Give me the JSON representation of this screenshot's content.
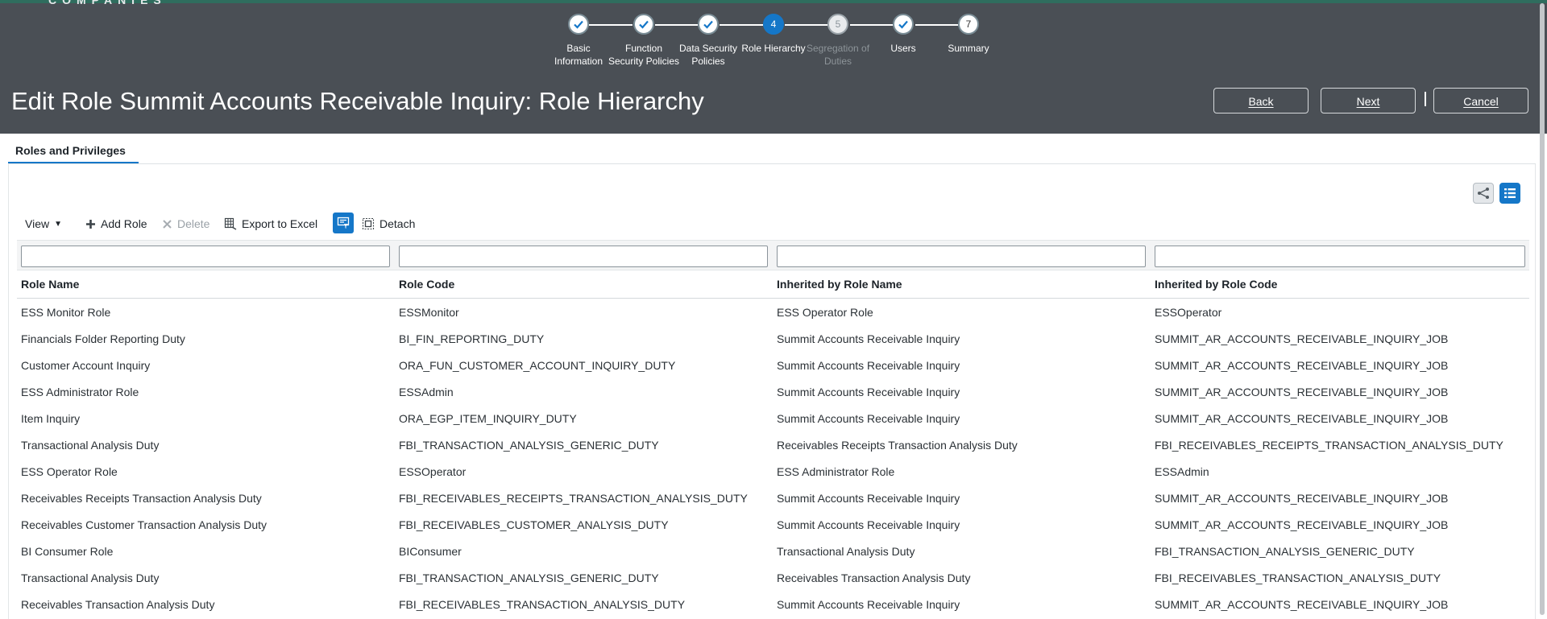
{
  "header": {
    "logo_fragment": "COMPANIES",
    "title": "Edit Role Summit Accounts Receivable Inquiry: Role Hierarchy",
    "buttons": {
      "back": "Back",
      "next": "Next",
      "cancel": "Cancel"
    }
  },
  "train": {
    "steps": [
      {
        "number": "1",
        "label_line1": "Basic",
        "label_line2": "Information",
        "state": "done"
      },
      {
        "number": "2",
        "label_line1": "Function",
        "label_line2": "Security Policies",
        "state": "done"
      },
      {
        "number": "3",
        "label_line1": "Data Security",
        "label_line2": "Policies",
        "state": "done"
      },
      {
        "number": "4",
        "label_line1": "Role Hierarchy",
        "label_line2": "",
        "state": "current"
      },
      {
        "number": "5",
        "label_line1": "Segregation of",
        "label_line2": "Duties",
        "state": "disabled"
      },
      {
        "number": "6",
        "label_line1": "Users",
        "label_line2": "",
        "state": "done"
      },
      {
        "number": "7",
        "label_line1": "Summary",
        "label_line2": "",
        "state": "todo"
      }
    ]
  },
  "tabs": {
    "roles_privileges": "Roles and Privileges"
  },
  "view_icons": {
    "graph": "hierarchy-graph-icon",
    "list": "list-view-icon"
  },
  "toolbar": {
    "view": "View",
    "add_role": "Add Role",
    "delete": "Delete",
    "export": "Export to Excel",
    "detach": "Detach"
  },
  "table": {
    "columns": [
      "Role Name",
      "Role Code",
      "Inherited by Role Name",
      "Inherited by Role Code"
    ],
    "rows": [
      [
        "ESS Monitor Role",
        "ESSMonitor",
        "ESS Operator Role",
        "ESSOperator"
      ],
      [
        "Financials Folder Reporting Duty",
        "BI_FIN_REPORTING_DUTY",
        "Summit Accounts Receivable Inquiry",
        "SUMMIT_AR_ACCOUNTS_RECEIVABLE_INQUIRY_JOB"
      ],
      [
        "Customer Account Inquiry",
        "ORA_FUN_CUSTOMER_ACCOUNT_INQUIRY_DUTY",
        "Summit Accounts Receivable Inquiry",
        "SUMMIT_AR_ACCOUNTS_RECEIVABLE_INQUIRY_JOB"
      ],
      [
        "ESS Administrator Role",
        "ESSAdmin",
        "Summit Accounts Receivable Inquiry",
        "SUMMIT_AR_ACCOUNTS_RECEIVABLE_INQUIRY_JOB"
      ],
      [
        "Item Inquiry",
        "ORA_EGP_ITEM_INQUIRY_DUTY",
        "Summit Accounts Receivable Inquiry",
        "SUMMIT_AR_ACCOUNTS_RECEIVABLE_INQUIRY_JOB"
      ],
      [
        "Transactional Analysis Duty",
        "FBI_TRANSACTION_ANALYSIS_GENERIC_DUTY",
        "Receivables Receipts Transaction Analysis Duty",
        "FBI_RECEIVABLES_RECEIPTS_TRANSACTION_ANALYSIS_DUTY"
      ],
      [
        "ESS Operator Role",
        "ESSOperator",
        "ESS Administrator Role",
        "ESSAdmin"
      ],
      [
        "Receivables Receipts Transaction Analysis Duty",
        "FBI_RECEIVABLES_RECEIPTS_TRANSACTION_ANALYSIS_DUTY",
        "Summit Accounts Receivable Inquiry",
        "SUMMIT_AR_ACCOUNTS_RECEIVABLE_INQUIRY_JOB"
      ],
      [
        "Receivables Customer Transaction Analysis Duty",
        "FBI_RECEIVABLES_CUSTOMER_ANALYSIS_DUTY",
        "Summit Accounts Receivable Inquiry",
        "SUMMIT_AR_ACCOUNTS_RECEIVABLE_INQUIRY_JOB"
      ],
      [
        "BI Consumer Role",
        "BIConsumer",
        "Transactional Analysis Duty",
        "FBI_TRANSACTION_ANALYSIS_GENERIC_DUTY"
      ],
      [
        "Transactional Analysis Duty",
        "FBI_TRANSACTION_ANALYSIS_GENERIC_DUTY",
        "Receivables Transaction Analysis Duty",
        "FBI_RECEIVABLES_TRANSACTION_ANALYSIS_DUTY"
      ],
      [
        "Receivables Transaction Analysis Duty",
        "FBI_RECEIVABLES_TRANSACTION_ANALYSIS_DUTY",
        "Summit Accounts Receivable Inquiry",
        "SUMMIT_AR_ACCOUNTS_RECEIVABLE_INQUIRY_JOB"
      ]
    ]
  },
  "colors": {
    "header_bg": "#4a4f55",
    "accent": "#1577c8",
    "header_top_stripe": "#2f6d5e"
  }
}
